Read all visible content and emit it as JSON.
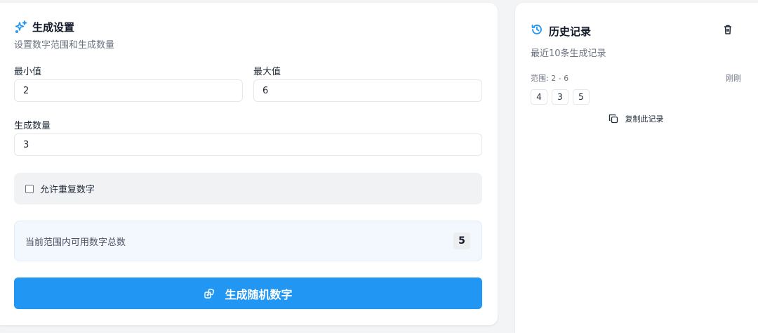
{
  "settings": {
    "title": "生成设置",
    "subtitle": "设置数字范围和生成数量",
    "min_label": "最小值",
    "min_value": "2",
    "max_label": "最大值",
    "max_value": "6",
    "count_label": "生成数量",
    "count_value": "3",
    "allow_repeat_label": "允许重复数字",
    "allow_repeat_checked": false,
    "available_label": "当前范围内可用数字总数",
    "available_count": "5",
    "generate_button": "生成随机数字"
  },
  "history": {
    "title": "历史记录",
    "subtitle": "最近10条生成记录",
    "records": [
      {
        "range_prefix": "范围: 2 - 6",
        "time": "刚刚",
        "numbers": [
          "4",
          "3",
          "5"
        ],
        "copy_label": "复制此记录"
      }
    ]
  },
  "colors": {
    "accent": "#2196f3",
    "card_bg": "#ffffff",
    "page_bg": "#f3f4f6"
  },
  "icons": {
    "settings_title": "sparkles-icon",
    "history_title": "history-icon",
    "clear_history": "trash-icon",
    "generate": "dice-icon",
    "copy": "copy-icon"
  }
}
